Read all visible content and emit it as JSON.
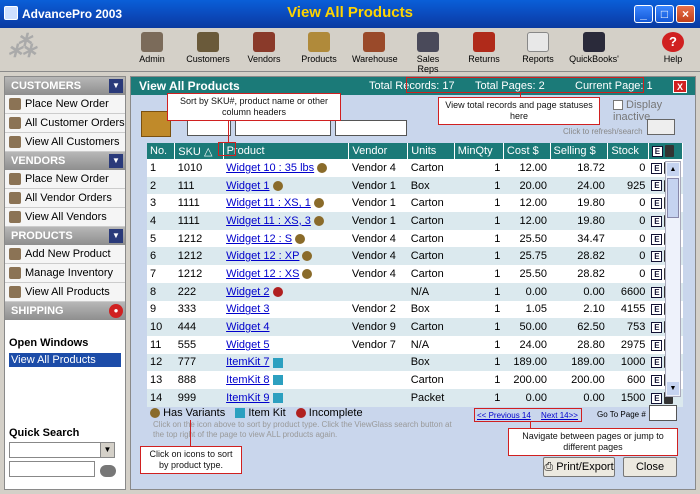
{
  "window": {
    "app_title": "AdvancePro 2003",
    "view_title": "View All Products"
  },
  "toolbar": [
    {
      "label": "Admin"
    },
    {
      "label": "Customers"
    },
    {
      "label": "Vendors"
    },
    {
      "label": "Products"
    },
    {
      "label": "Warehouse"
    },
    {
      "label": "Sales Reps"
    },
    {
      "label": "Returns"
    },
    {
      "label": "Reports"
    },
    {
      "label": "QuickBooks'"
    },
    {
      "label": "Help"
    }
  ],
  "sidebar": {
    "customers": {
      "title": "CUSTOMERS",
      "items": [
        "Place New Order",
        "All Customer Orders",
        "View All Customers"
      ]
    },
    "vendors": {
      "title": "VENDORS",
      "items": [
        "Place New Order",
        "All Vendor Orders",
        "View All Vendors"
      ]
    },
    "products": {
      "title": "PRODUCTS",
      "items": [
        "Add New Product",
        "Manage Inventory",
        "View All Products"
      ]
    },
    "shipping": {
      "title": "SHIPPING"
    },
    "open_windows": {
      "title": "Open Windows",
      "item": "View All Products"
    },
    "quick_search": {
      "title": "Quick Search"
    }
  },
  "main": {
    "title": "View All Products",
    "total_records": "Total Records: 17",
    "total_pages": "Total Pages:  2",
    "current_page": "Current Page:  1",
    "display_inactive": "Display inactive",
    "refresh_hint": "Click to refresh/search",
    "columns": [
      "No.",
      "SKU",
      "Product",
      "Vendor",
      "Units",
      "MinQty",
      "Cost $",
      "Selling $",
      "Stock"
    ],
    "rows": [
      [
        "1",
        "1010",
        "Widget 10 : 35 lbs",
        "Vendor 4",
        "Carton",
        "1",
        "12.00",
        "18.72",
        "0",
        "v"
      ],
      [
        "2",
        "111",
        "Widget 1",
        "Vendor 1",
        "Box",
        "1",
        "20.00",
        "24.00",
        "925",
        "v"
      ],
      [
        "3",
        "1111",
        "Widget 11 : XS, 1",
        "Vendor 1",
        "Carton",
        "1",
        "12.00",
        "19.80",
        "0",
        "v"
      ],
      [
        "4",
        "1111",
        "Widget 11 : XS, 3",
        "Vendor 1",
        "Carton",
        "1",
        "12.00",
        "19.80",
        "0",
        "v"
      ],
      [
        "5",
        "1212",
        "Widget 12 : S",
        "Vendor 4",
        "Carton",
        "1",
        "25.50",
        "34.47",
        "0",
        "v"
      ],
      [
        "6",
        "1212",
        "Widget 12 : XP",
        "Vendor 4",
        "Carton",
        "1",
        "25.75",
        "28.82",
        "0",
        "v"
      ],
      [
        "7",
        "1212",
        "Widget 12 : XS",
        "Vendor 4",
        "Carton",
        "1",
        "25.50",
        "28.82",
        "0",
        "v"
      ],
      [
        "8",
        "222",
        "Widget 2",
        "",
        "N/A",
        "1",
        "0.00",
        "0.00",
        "6600",
        "c"
      ],
      [
        "9",
        "333",
        "Widget 3",
        "Vendor 2",
        "Box",
        "1",
        "1.05",
        "2.10",
        "4155",
        "n"
      ],
      [
        "10",
        "444",
        "Widget 4",
        "Vendor 9",
        "Carton",
        "1",
        "50.00",
        "62.50",
        "753",
        "n"
      ],
      [
        "11",
        "555",
        "Widget 5",
        "Vendor 7",
        "N/A",
        "1",
        "24.00",
        "28.80",
        "2975",
        "n"
      ],
      [
        "12",
        "777",
        "ItemKit 7",
        "",
        "Box",
        "1",
        "189.00",
        "189.00",
        "1000",
        "k"
      ],
      [
        "13",
        "888",
        "ItemKit 8",
        "",
        "Carton",
        "1",
        "200.00",
        "200.00",
        "600",
        "k"
      ],
      [
        "14",
        "999",
        "ItemKit 9",
        "",
        "Packet",
        "1",
        "0.00",
        "0.00",
        "1500",
        "k"
      ]
    ],
    "legend": {
      "variants": "Has Variants",
      "kit": "Item Kit",
      "incomplete": "Incomplete"
    },
    "help_text": "Click on the icon above to sort by product type. Click the ViewGlass search button at the top right of the page to view ALL products again.",
    "prev": "<< Previous 14",
    "next": "Next 14>>",
    "goto": "Go To Page #",
    "print_btn": "Print/Export",
    "close_btn": "Close"
  },
  "callouts": {
    "sort": "Sort by SKU#, product name or other column headers",
    "records": "View total records and page statuses here",
    "icons": "Click on icons to sort by product type.",
    "nav": "Navigate between pages or jump to different pages"
  },
  "colors": {
    "header_teal": "#1b7a78",
    "callout_red": "#d02020",
    "title_yellow": "#ffd400"
  }
}
